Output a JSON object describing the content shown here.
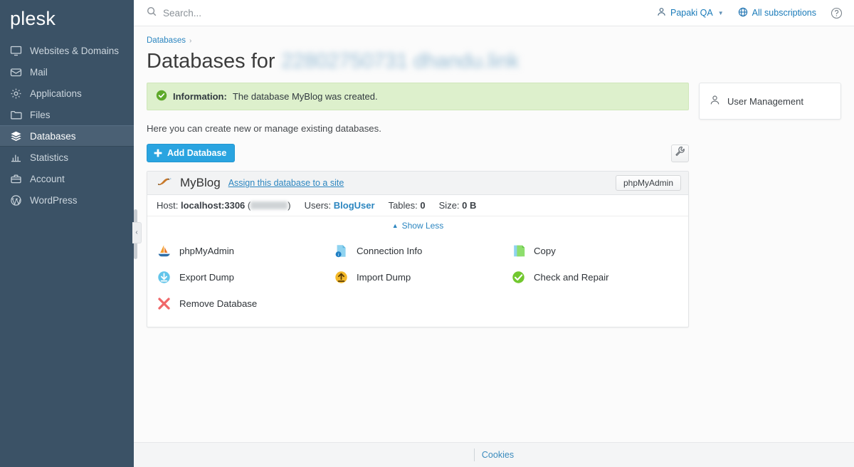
{
  "brand": {
    "name": "plesk",
    "accent": "#5ec8e8"
  },
  "sidebar": {
    "items": [
      {
        "label": "Websites & Domains",
        "icon": "monitor-icon",
        "active": false
      },
      {
        "label": "Mail",
        "icon": "envelope-icon",
        "active": false
      },
      {
        "label": "Applications",
        "icon": "gear-icon",
        "active": false
      },
      {
        "label": "Files",
        "icon": "folder-icon",
        "active": false
      },
      {
        "label": "Databases",
        "icon": "layers-icon",
        "active": true
      },
      {
        "label": "Statistics",
        "icon": "bar-chart-icon",
        "active": false
      },
      {
        "label": "Account",
        "icon": "briefcase-icon",
        "active": false
      },
      {
        "label": "WordPress",
        "icon": "wordpress-icon",
        "active": false
      }
    ],
    "collapse_label": "‹"
  },
  "topbar": {
    "search_placeholder": "Search...",
    "search_value": "",
    "user_label": "Papaki QA",
    "subscriptions_label": "All subscriptions",
    "help_label": "?"
  },
  "breadcrumb": {
    "items": [
      "Databases"
    ],
    "separator": "›"
  },
  "page": {
    "title_prefix": "Databases for",
    "title_domain_redacted": "22802750731 dhandu.link"
  },
  "alert": {
    "severity_label": "Information:",
    "message": "The database MyBlog was created.",
    "bg": "#ddf0cc",
    "icon": "check-circle-icon"
  },
  "lede": "Here you can create new or manage existing databases.",
  "toolbar": {
    "add_database_label": "Add Database",
    "add_database_color": "#2aa4e0",
    "tools_icon": "wrench-icon"
  },
  "database": {
    "engine_icon": "mysql-dolphin-icon",
    "name": "MyBlog",
    "assign_link": "Assign this database to a site",
    "phpmyadmin_button": "phpMyAdmin",
    "meta": {
      "host_label": "Host:",
      "host_value": "localhost:3306",
      "host_extra_redacted": "",
      "users_label": "Users:",
      "users_value": "BlogUser",
      "tables_label": "Tables:",
      "tables_value": "0",
      "size_label": "Size:",
      "size_value": "0 B"
    },
    "show_less_label": "Show Less",
    "actions": [
      {
        "label": "phpMyAdmin",
        "icon": "phpmyadmin-sailboat-icon"
      },
      {
        "label": "Connection Info",
        "icon": "info-document-icon"
      },
      {
        "label": "Copy",
        "icon": "copy-document-icon"
      },
      {
        "label": "Export Dump",
        "icon": "download-arrow-icon"
      },
      {
        "label": "Import Dump",
        "icon": "upload-arrow-icon"
      },
      {
        "label": "Check and Repair",
        "icon": "green-check-icon"
      },
      {
        "label": "Remove Database",
        "icon": "red-x-icon"
      }
    ]
  },
  "side_panel": {
    "items": [
      {
        "label": "User Management",
        "icon": "person-icon"
      }
    ]
  },
  "footer": {
    "cookies_label": "Cookies"
  }
}
